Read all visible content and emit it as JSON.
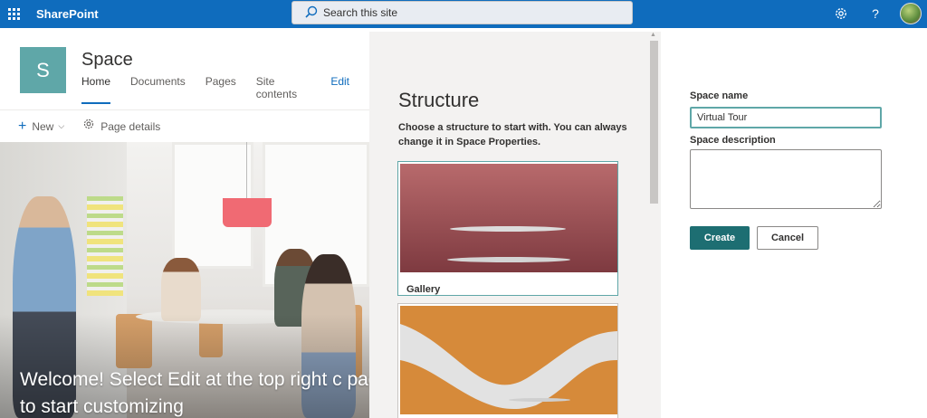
{
  "suitebar": {
    "app_name": "SharePoint",
    "search_placeholder": "Search this site",
    "colors": {
      "bar": "#0f6cbd"
    }
  },
  "site": {
    "logo_letter": "S",
    "title": "Space",
    "nav": [
      {
        "label": "Home",
        "active": true
      },
      {
        "label": "Documents"
      },
      {
        "label": "Pages"
      },
      {
        "label": "Site contents"
      },
      {
        "label": "Edit"
      }
    ]
  },
  "commandbar": {
    "new_label": "New",
    "page_details_label": "Page details"
  },
  "hero": {
    "welcome_text": "Welcome! Select Edit at the top right c page to start customizing"
  },
  "structure_panel": {
    "title": "Structure",
    "description": "Choose a structure to start with. You can always change it in Space Properties.",
    "cards": [
      {
        "label": "Gallery",
        "selected": true
      },
      {
        "label": ""
      }
    ]
  },
  "form": {
    "space_name_label": "Space name",
    "space_name_value": "Virtual Tour",
    "space_description_label": "Space description",
    "space_description_value": "",
    "create_label": "Create",
    "cancel_label": "Cancel",
    "accent_color": "#1d6e72"
  }
}
